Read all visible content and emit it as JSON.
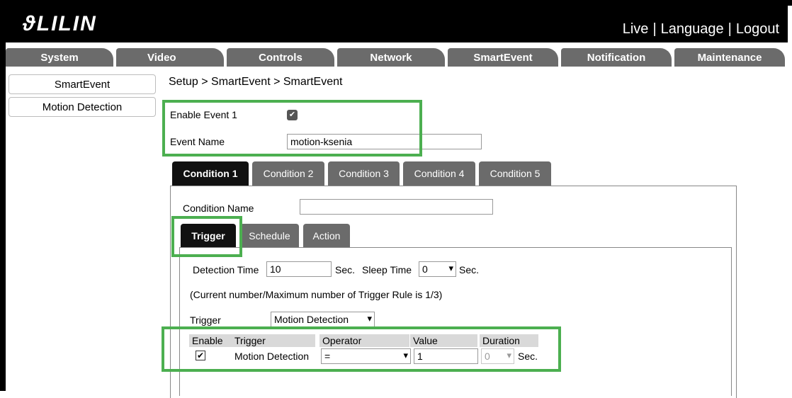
{
  "header": {
    "logo": "LILIN",
    "links": [
      "Live",
      "Language",
      "Logout"
    ],
    "separator": "|"
  },
  "nav": {
    "tabs": [
      "System",
      "Video",
      "Controls",
      "Network",
      "SmartEvent",
      "Notification",
      "Maintenance"
    ],
    "active": "SmartEvent"
  },
  "sidebar": {
    "items": [
      "SmartEvent",
      "Motion Detection"
    ]
  },
  "breadcrumb": "Setup > SmartEvent > SmartEvent",
  "event": {
    "enable_label": "Enable Event 1",
    "enabled": true,
    "name_label": "Event Name",
    "name_value": "motion-ksenia"
  },
  "conditions": {
    "tabs": [
      "Condition 1",
      "Condition 2",
      "Condition 3",
      "Condition 4",
      "Condition 5"
    ],
    "active": "Condition 1",
    "name_label": "Condition Name",
    "name_value": ""
  },
  "subtabs": {
    "tabs": [
      "Trigger",
      "Schedule",
      "Action"
    ],
    "active": "Trigger"
  },
  "trigger_panel": {
    "detection_time_label": "Detection Time",
    "detection_time_value": "10",
    "sec_label": "Sec.",
    "sleep_time_label": "Sleep Time",
    "sleep_time_value": "0",
    "sleep_sec_label": "Sec.",
    "info": "(Current number/Maximum number of Trigger Rule is 1/3)",
    "trigger_label": "Trigger",
    "trigger_value": "Motion Detection"
  },
  "rule_table": {
    "headers": [
      "Enable",
      "Trigger",
      "Operator",
      "Value",
      "Duration"
    ],
    "rows": [
      {
        "enabled": true,
        "trigger": "Motion Detection",
        "operator": "=",
        "value": "1",
        "duration": "0",
        "duration_unit": "Sec."
      }
    ]
  },
  "colors": {
    "highlight": "#4caf50",
    "nav_tab": "#6b6b6b",
    "active_tab": "#111111"
  }
}
